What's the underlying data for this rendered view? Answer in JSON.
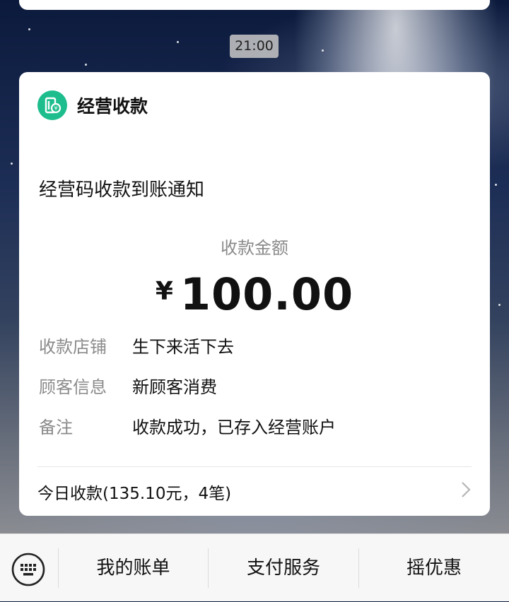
{
  "chat": {
    "timestamp": "21:00"
  },
  "card": {
    "app_name": "经营收款",
    "title": "经营码收款到账通知",
    "amount_label": "收款金额",
    "currency_symbol": "¥",
    "amount": "100.00",
    "details": [
      {
        "label": "收款店铺",
        "value": "生下来活下去"
      },
      {
        "label": "顾客信息",
        "value": "新顾客消费"
      },
      {
        "label": "备注",
        "value": "收款成功，已存入经营账户"
      }
    ],
    "summary": "今日收款(135.10元，4笔)",
    "accent_color": "#1ebd8d"
  },
  "bottom_menu": {
    "keyboard_icon": "keyboard-icon",
    "items": [
      {
        "label": "我的账单"
      },
      {
        "label": "支付服务"
      },
      {
        "label": "摇优惠"
      }
    ]
  }
}
